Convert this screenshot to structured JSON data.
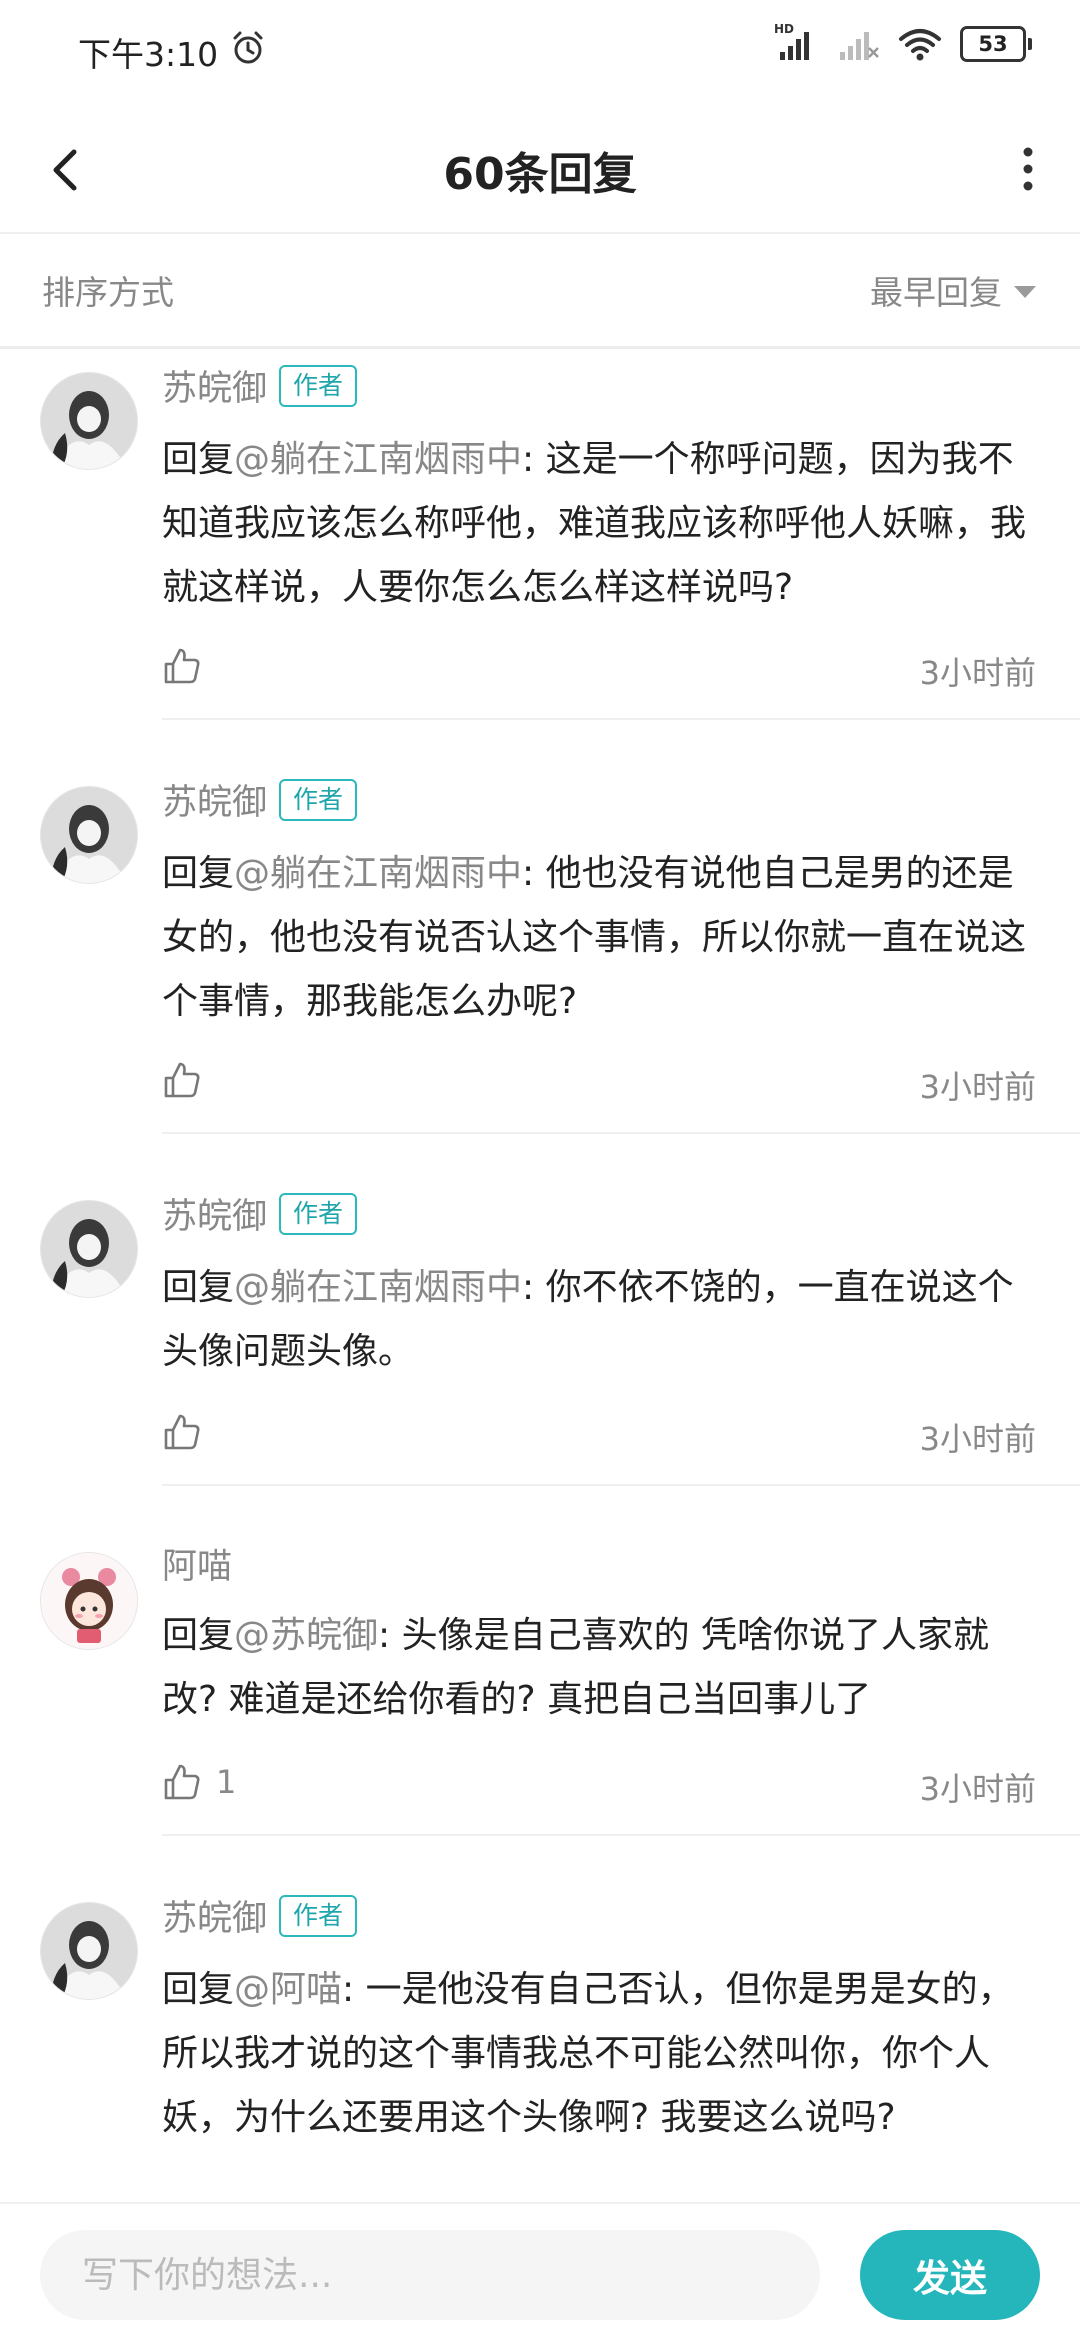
{
  "status_bar": {
    "time": "下午3:10",
    "network_label": "HD",
    "battery": "53"
  },
  "nav": {
    "title": "60条回复"
  },
  "sort": {
    "label": "排序方式",
    "selected": "最早回复"
  },
  "replies": [
    {
      "name": "苏皖御",
      "badge": "作者",
      "reply_prefix": "回复",
      "mention": "@躺在江南烟雨中",
      "text": ": 这是一个称呼问题，因为我不知道我应该怎么称呼他，难道我应该称呼他人妖嘛，我就这样说，人要你怎么怎么样这样说吗?",
      "time": "3小时前",
      "likes": ""
    },
    {
      "name": "苏皖御",
      "badge": "作者",
      "reply_prefix": "回复",
      "mention": "@躺在江南烟雨中",
      "text": ": 他也没有说他自己是男的还是女的，他也没有说否认这个事情，所以你就一直在说这个事情，那我能怎么办呢?",
      "time": "3小时前",
      "likes": ""
    },
    {
      "name": "苏皖御",
      "badge": "作者",
      "reply_prefix": "回复",
      "mention": "@躺在江南烟雨中",
      "text": ": 你不依不饶的，一直在说这个头像问题头像。",
      "time": "3小时前",
      "likes": ""
    },
    {
      "name": "阿喵",
      "badge": "",
      "reply_prefix": "回复",
      "mention": "@苏皖御",
      "text": ": 头像是自己喜欢的  凭啥你说了人家就改? 难道是还给你看的? 真把自己当回事儿了",
      "time": "3小时前",
      "likes": "1"
    },
    {
      "name": "苏皖御",
      "badge": "作者",
      "reply_prefix": "回复",
      "mention": "@阿喵",
      "text": ": 一是他没有自己否认，但你是男是女的，所以我才说的这个事情我总不可能公然叫你，你个人妖，为什么还要用这个头像啊? 我要这么说吗?",
      "time": "",
      "likes": ""
    }
  ],
  "composer": {
    "placeholder": "写下你的想法...",
    "send_label": "发送"
  },
  "colors": {
    "accent": "#25b6bb",
    "muted_text": "#888888",
    "primary_text": "#222222"
  }
}
